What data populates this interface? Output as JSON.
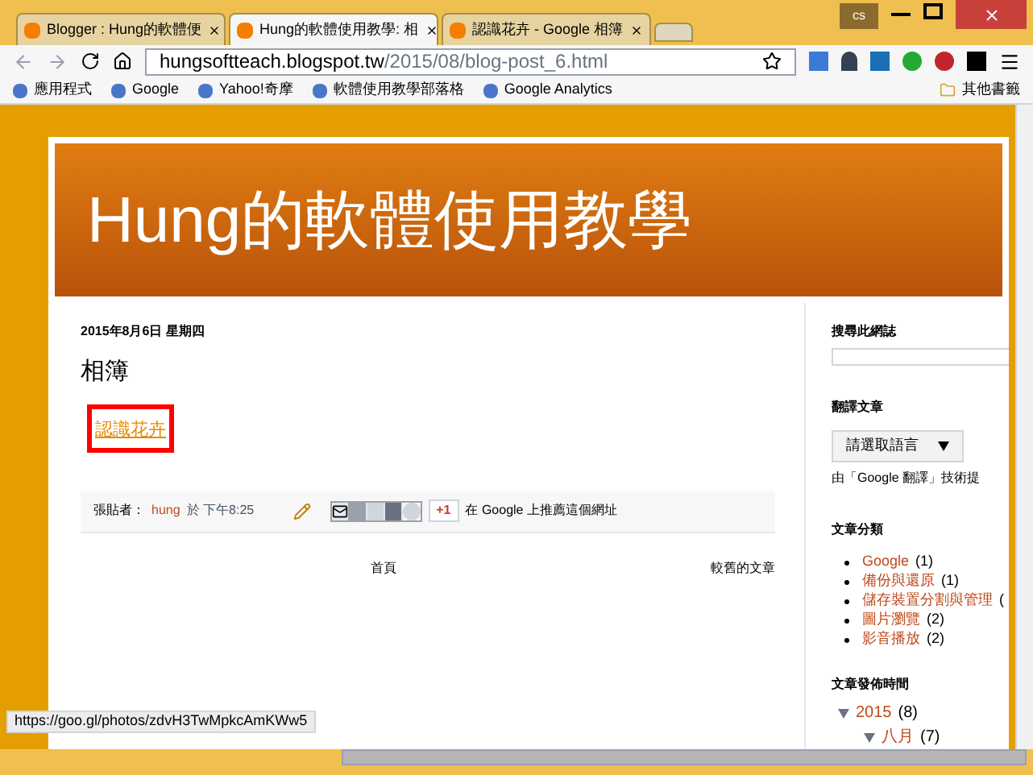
{
  "window": {
    "user": "cs"
  },
  "tabs": [
    {
      "title": "Blogger : Hung的軟體便",
      "selected": false
    },
    {
      "title": "Hung的軟體使用教學: 相",
      "selected": true
    },
    {
      "title": "認識花卉 - Google 相簿",
      "selected": false
    }
  ],
  "address": {
    "host": "hungsoftteach.blogspot.tw",
    "path": "/2015/08/blog-post_6.html"
  },
  "bookmarks": [
    "應用程式",
    "Google",
    "Yahoo!奇摩",
    "軟體使用教學部落格",
    "Google Analytics"
  ],
  "other_bookmarks": "其他書籤",
  "blog": {
    "title": "Hung的軟體使用教學"
  },
  "post": {
    "date": "2015年8月6日 星期四",
    "title": "相簿",
    "link": "認識花卉",
    "author_label": "張貼者：",
    "author": "hung",
    "time": "於 下午8:25",
    "plus": "+1",
    "recommend": "在 Google 上推薦這個網址"
  },
  "pager": {
    "home": "首頁",
    "older": "較舊的文章"
  },
  "sidebar": {
    "search_title": "搜尋此網誌",
    "translate_title": "翻譯文章",
    "language_select": "請選取語言",
    "powered": "由「Google 翻譯」技術提",
    "categories_title": "文章分類",
    "categories": [
      {
        "name": "Google",
        "count": "(1)"
      },
      {
        "name": "備份與還原",
        "count": "(1)"
      },
      {
        "name": "儲存裝置分割與管理",
        "count": "("
      },
      {
        "name": "圖片瀏覽",
        "count": "(2)"
      },
      {
        "name": "影音播放",
        "count": "(2)"
      }
    ],
    "archive_title": "文章發佈時間",
    "archive": [
      {
        "label": "2015",
        "count": "(8)",
        "expanded": true,
        "children": [
          {
            "label": "八月",
            "count": "(7)",
            "expanded": true
          }
        ]
      }
    ]
  },
  "status_bar": "https://goo.gl/photos/zdvH3TwMpkcAmKWw5"
}
